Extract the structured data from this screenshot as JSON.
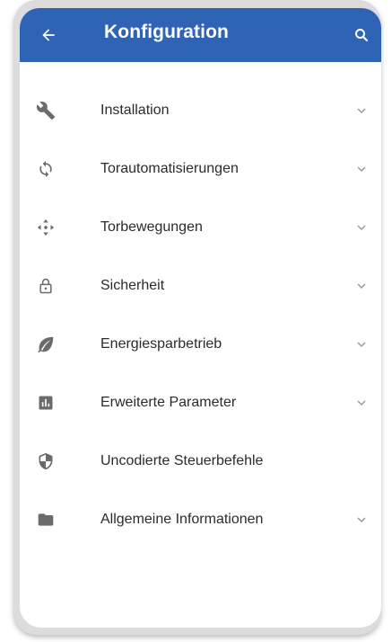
{
  "appbar": {
    "title": "Konfiguration",
    "back_icon": "arrow-left-icon",
    "search_icon": "search-icon",
    "color": "#2f63b4"
  },
  "menu": {
    "items": [
      {
        "label": "Installation",
        "icon": "wrench-icon",
        "expandable": true
      },
      {
        "label": "Torautomatisierungen",
        "icon": "sync-icon",
        "expandable": true
      },
      {
        "label": "Torbewegungen",
        "icon": "move-arrows-icon",
        "expandable": true
      },
      {
        "label": "Sicherheit",
        "icon": "lock-icon",
        "expandable": true
      },
      {
        "label": "Energiesparbetrieb",
        "icon": "leaf-icon",
        "expandable": true
      },
      {
        "label": "Erweiterte Parameter",
        "icon": "chart-box-icon",
        "expandable": true
      },
      {
        "label": "Uncodierte Steuerbefehle",
        "icon": "shield-icon",
        "expandable": false
      },
      {
        "label": "Allgemeine Informationen",
        "icon": "folder-icon",
        "expandable": true
      }
    ]
  },
  "colors": {
    "icon": "#6b6b6b",
    "text": "#2b2b2b",
    "chevron": "#9a9a9a"
  }
}
